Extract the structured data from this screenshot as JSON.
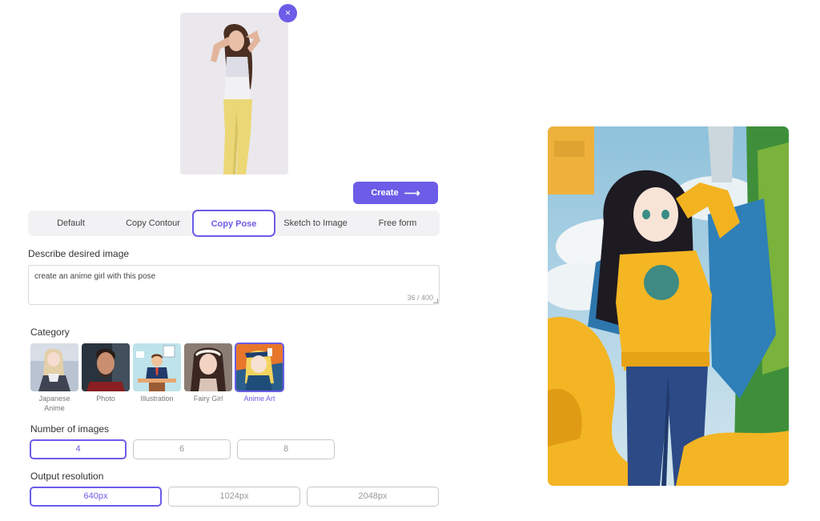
{
  "tabs": [
    "Default",
    "Copy Contour",
    "Copy Pose",
    "Sketch to Image",
    "Free form"
  ],
  "active_tab": "Copy Pose",
  "create_label": "Create",
  "remove_symbol": "×",
  "describe": {
    "label": "Describe desired image",
    "value": "create an anime girl with this pose",
    "counter": "36 / 400"
  },
  "category": {
    "label": "Category",
    "items": [
      "Japanese Anime",
      "Photo",
      "Illustration",
      "Fairy Girl",
      "Anime Art"
    ],
    "selected": "Anime Art"
  },
  "num_images": {
    "label": "Number of images",
    "options": [
      "4",
      "6",
      "8"
    ],
    "selected": "4"
  },
  "resolution": {
    "label": "Output resolution",
    "options": [
      "640px",
      "1024px",
      "2048px"
    ],
    "selected": "640px"
  },
  "colors": {
    "accent": "#6c5ce7"
  }
}
